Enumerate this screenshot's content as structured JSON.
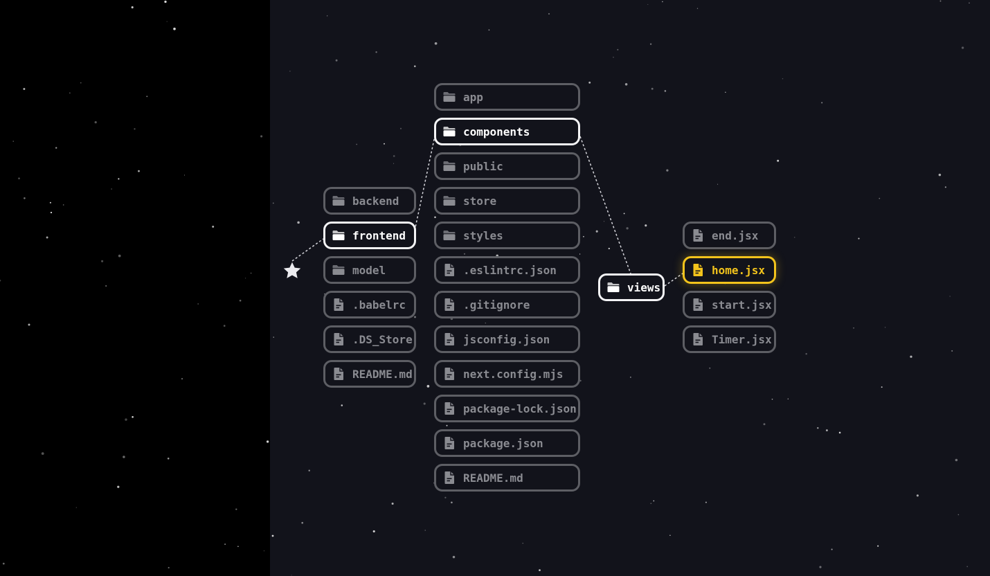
{
  "colors": {
    "background": "#12131b",
    "left_panel": "#000000",
    "node_border": "#5d5e64",
    "node_text": "#8a8b91",
    "active": "#ffffff",
    "selected": "#f2c31c"
  },
  "root": {
    "icon": "star-icon"
  },
  "columns": [
    {
      "items": [
        {
          "label": "backend",
          "type": "folder"
        },
        {
          "label": "frontend",
          "type": "folder",
          "state": "active"
        },
        {
          "label": "model",
          "type": "folder"
        },
        {
          "label": ".babelrc",
          "type": "file"
        },
        {
          "label": ".DS_Store",
          "type": "file"
        },
        {
          "label": "README.md",
          "type": "file"
        }
      ]
    },
    {
      "items": [
        {
          "label": "app",
          "type": "folder"
        },
        {
          "label": "components",
          "type": "folder",
          "state": "active"
        },
        {
          "label": "public",
          "type": "folder"
        },
        {
          "label": "store",
          "type": "folder"
        },
        {
          "label": "styles",
          "type": "folder"
        },
        {
          "label": ".eslintrc.json",
          "type": "file"
        },
        {
          "label": ".gitignore",
          "type": "file"
        },
        {
          "label": "jsconfig.json",
          "type": "file"
        },
        {
          "label": "next.config.mjs",
          "type": "file"
        },
        {
          "label": "package-lock.json",
          "type": "file"
        },
        {
          "label": "package.json",
          "type": "file"
        },
        {
          "label": "README.md",
          "type": "file"
        }
      ]
    },
    {
      "items": [
        {
          "label": "views",
          "type": "folder",
          "state": "active"
        }
      ]
    },
    {
      "items": [
        {
          "label": "end.jsx",
          "type": "file"
        },
        {
          "label": "home.jsx",
          "type": "file",
          "state": "selected"
        },
        {
          "label": "start.jsx",
          "type": "file"
        },
        {
          "label": "Timer.jsx",
          "type": "file"
        }
      ]
    }
  ]
}
